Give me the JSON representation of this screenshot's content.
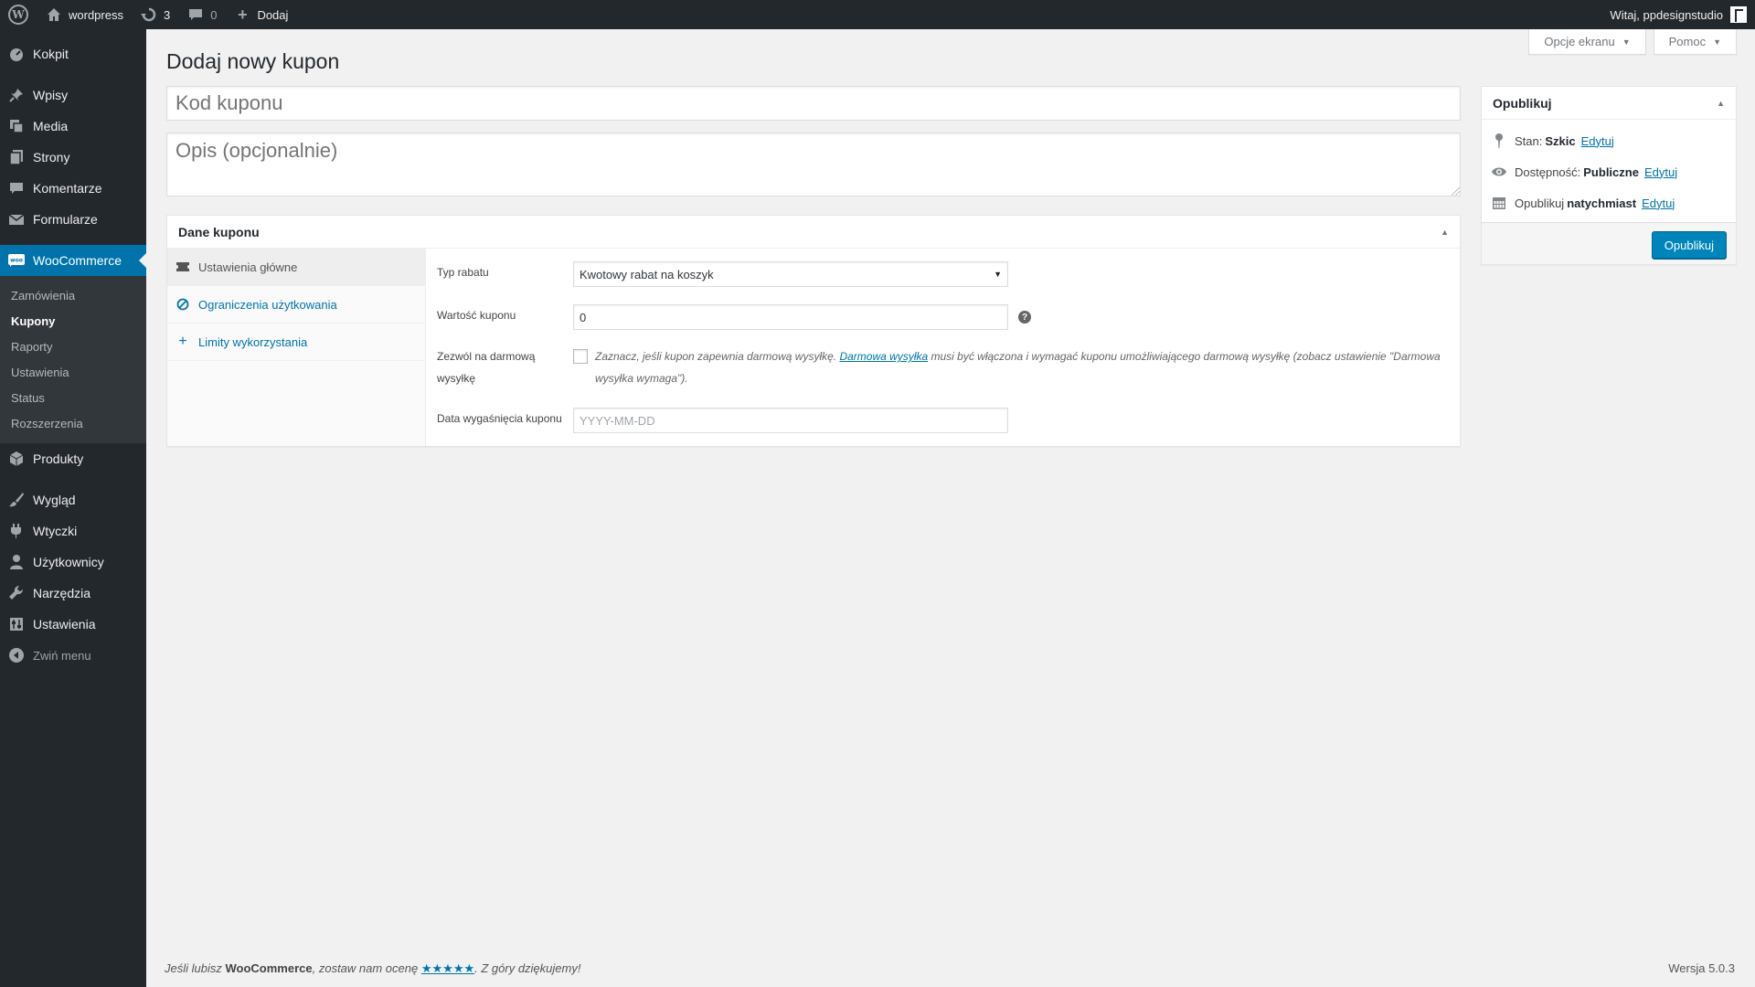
{
  "adminbar": {
    "site_name": "wordpress",
    "updates_count": "3",
    "comments_count": "0",
    "add_label": "Dodaj",
    "greeting": "Witaj, ppdesignstudio"
  },
  "sidebar": {
    "items": [
      {
        "label": "Kokpit",
        "icon": "dashboard-icon"
      },
      {
        "label": "Wpisy",
        "icon": "pin-icon"
      },
      {
        "label": "Media",
        "icon": "media-icon"
      },
      {
        "label": "Strony",
        "icon": "pages-icon"
      },
      {
        "label": "Komentarze",
        "icon": "comment-icon"
      },
      {
        "label": "Formularze",
        "icon": "envelope-icon"
      },
      {
        "label": "WooCommerce",
        "icon": "woo-icon"
      },
      {
        "label": "Produkty",
        "icon": "box-icon"
      },
      {
        "label": "Wygląd",
        "icon": "brush-icon"
      },
      {
        "label": "Wtyczki",
        "icon": "plugin-icon"
      },
      {
        "label": "Użytkownicy",
        "icon": "user-icon"
      },
      {
        "label": "Narzędzia",
        "icon": "wrench-icon"
      },
      {
        "label": "Ustawienia",
        "icon": "settings-icon"
      }
    ],
    "woo_submenu": [
      "Zamówienia",
      "Kupony",
      "Raporty",
      "Ustawienia",
      "Status",
      "Rozszerzenia"
    ],
    "collapse_label": "Zwiń menu"
  },
  "screen_meta": {
    "options_label": "Opcje ekranu",
    "help_label": "Pomoc"
  },
  "page": {
    "title": "Dodaj nowy kupon",
    "code_placeholder": "Kod kuponu",
    "desc_placeholder": "Opis (opcjonalnie)"
  },
  "coupon": {
    "box_title": "Dane kuponu",
    "tabs": [
      "Ustawienia główne",
      "Ograniczenia użytkowania",
      "Limity wykorzystania"
    ],
    "discount_type_label": "Typ rabatu",
    "discount_type_value": "Kwotowy rabat na koszyk",
    "amount_label": "Wartość kuponu",
    "amount_value": "0",
    "free_shipping_label": "Zezwól na darmową wysyłkę",
    "free_shipping_desc_1": "Zaznacz, jeśli kupon zapewnia darmową wysyłkę.",
    "free_shipping_link": "Darmowa wysyłka",
    "free_shipping_desc_2": "musi być włączona i wymagać kuponu umożliwiającego darmową wysyłkę (zobacz ustawienie \"Darmowa wysyłka wymaga\").",
    "expiry_label": "Data wygaśnięcia kuponu",
    "expiry_placeholder": "YYYY-MM-DD"
  },
  "publish": {
    "title": "Opublikuj",
    "status_label": "Stan:",
    "status_value": "Szkic",
    "visibility_label": "Dostępność:",
    "visibility_value": "Publiczne",
    "schedule_label": "Opublikuj",
    "schedule_value": "natychmiast",
    "edit_label": "Edytuj",
    "button_label": "Opublikuj"
  },
  "footer": {
    "text_1": "Jeśli lubisz",
    "brand": "WooCommerce",
    "text_2": ", zostaw nam ocenę",
    "stars": "★★★★★",
    "text_3": ". Z góry dziękujemy!",
    "version": "Wersja 5.0.3"
  },
  "colors": {
    "accent": "#0073aa",
    "sidebar_bg": "#23282d",
    "publish_button": "#0085ba"
  }
}
